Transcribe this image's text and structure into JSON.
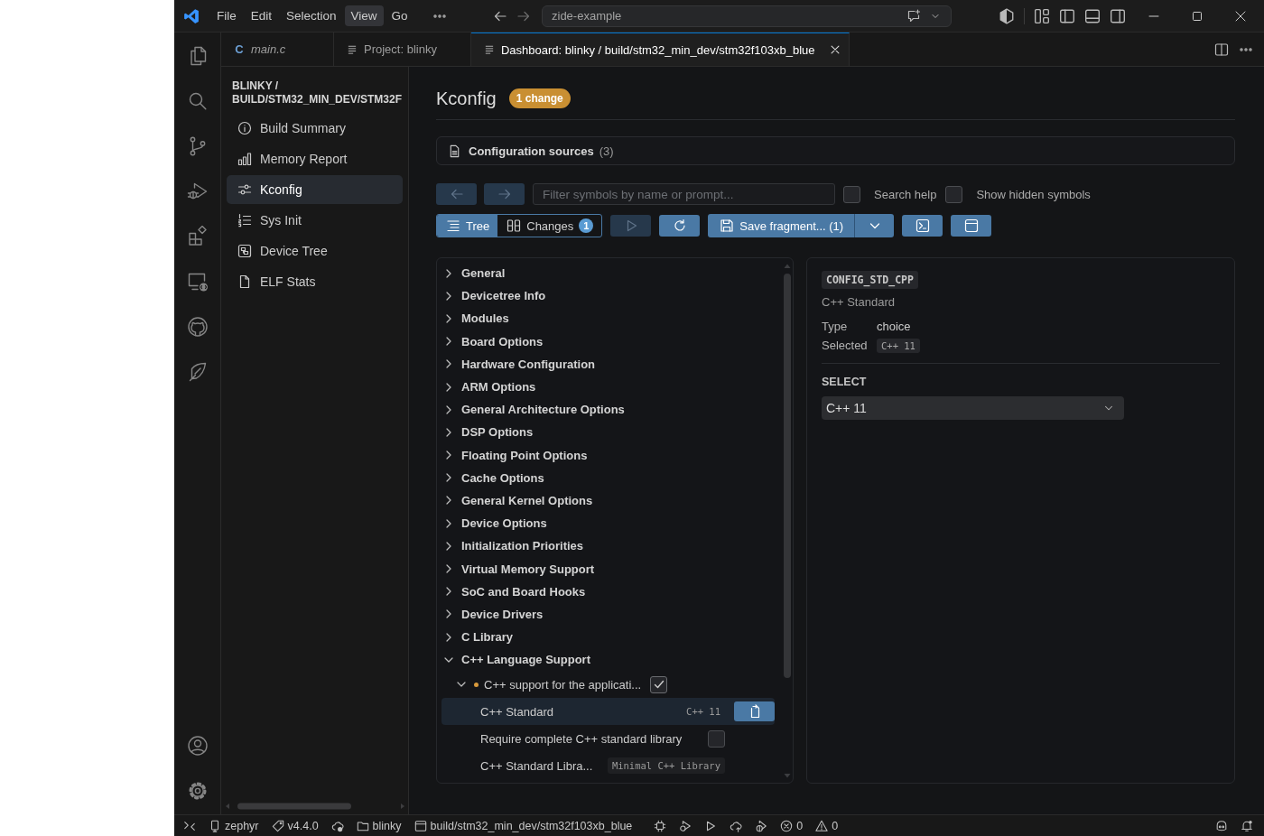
{
  "title_bar": {
    "menu": [
      {
        "label": "File",
        "selected": false
      },
      {
        "label": "Edit",
        "selected": false
      },
      {
        "label": "Selection",
        "selected": false
      },
      {
        "label": "View",
        "selected": true
      },
      {
        "label": "Go",
        "selected": false
      }
    ],
    "command_center": "zide-example"
  },
  "tabs": [
    {
      "label": "main.c",
      "kind": "source",
      "icon_text": "C",
      "preview": true,
      "selected": false
    },
    {
      "label": "Project: blinky",
      "kind": "document",
      "preview": false,
      "selected": false
    },
    {
      "label": "Dashboard: blinky / build/stm32_min_dev/stm32f103xb_blue",
      "kind": "document",
      "preview": false,
      "selected": true
    }
  ],
  "dashboard_nav": {
    "title": "BLINKY / BUILD/STM32_MIN_DEV/STM32F",
    "items": [
      {
        "label": "Build Summary",
        "kind": "summary",
        "selected": false
      },
      {
        "label": "Memory Report",
        "kind": "memory",
        "selected": false
      },
      {
        "label": "Kconfig",
        "kind": "kconfig",
        "selected": true
      },
      {
        "label": "Sys Init",
        "kind": "sysinit",
        "selected": false
      },
      {
        "label": "Device Tree",
        "kind": "devicetree",
        "selected": false
      },
      {
        "label": "ELF Stats",
        "kind": "elf",
        "selected": false
      }
    ]
  },
  "kconfig": {
    "title": "Kconfig",
    "badge": "1 change",
    "sources": {
      "label": "Configuration sources",
      "count": "(3)"
    },
    "nav_buttons": [
      {
        "kind": "back",
        "disabled": true
      },
      {
        "kind": "forward",
        "disabled": true
      }
    ],
    "filter": {
      "placeholder": "Filter symbols by name or prompt..."
    },
    "options": [
      {
        "label": "Search help",
        "checked": false
      },
      {
        "label": "Show hidden symbols",
        "checked": false
      }
    ],
    "views": [
      {
        "label": "Tree",
        "kind": "tree",
        "selected": true
      },
      {
        "label": "Changes",
        "kind": "changes",
        "badge": "1",
        "selected": false
      }
    ],
    "actions": [
      {
        "kind": "run",
        "disabled": true
      },
      {
        "kind": "refresh",
        "disabled": false
      },
      {
        "kind": "save",
        "label": "Save fragment... (1)",
        "disabled": false
      },
      {
        "kind": "save-menu",
        "disabled": false
      },
      {
        "kind": "terminal",
        "disabled": false
      },
      {
        "kind": "panel",
        "disabled": false
      }
    ],
    "tree": {
      "items": [
        {
          "label": "General",
          "kind": "menu",
          "expanded": false,
          "selected": false
        },
        {
          "label": "Devicetree Info",
          "kind": "menu",
          "expanded": false,
          "selected": false
        },
        {
          "label": "Modules",
          "kind": "menu",
          "expanded": false,
          "selected": false
        },
        {
          "label": "Board Options",
          "kind": "menu",
          "expanded": false,
          "selected": false
        },
        {
          "label": "Hardware Configuration",
          "kind": "menu",
          "expanded": false,
          "selected": false
        },
        {
          "label": "ARM Options",
          "kind": "menu",
          "expanded": false,
          "selected": false
        },
        {
          "label": "General Architecture Options",
          "kind": "menu",
          "expanded": false,
          "selected": false
        },
        {
          "label": "DSP Options",
          "kind": "menu",
          "expanded": false,
          "selected": false
        },
        {
          "label": "Floating Point Options",
          "kind": "menu",
          "expanded": false,
          "selected": false
        },
        {
          "label": "Cache Options",
          "kind": "menu",
          "expanded": false,
          "selected": false
        },
        {
          "label": "General Kernel Options",
          "kind": "menu",
          "expanded": false,
          "selected": false
        },
        {
          "label": "Device Options",
          "kind": "menu",
          "expanded": false,
          "selected": false
        },
        {
          "label": "Initialization Priorities",
          "kind": "menu",
          "expanded": false,
          "selected": false
        },
        {
          "label": "Virtual Memory Support",
          "kind": "menu",
          "expanded": false,
          "selected": false
        },
        {
          "label": "SoC and Board Hooks",
          "kind": "menu",
          "expanded": false,
          "selected": false
        },
        {
          "label": "Device Drivers",
          "kind": "menu",
          "expanded": false,
          "selected": false
        },
        {
          "label": "C Library",
          "kind": "menu",
          "expanded": false,
          "selected": false
        },
        {
          "label": "C++ Language Support",
          "kind": "menu",
          "expanded": true,
          "selected": false,
          "children": [
            {
              "label": "C++ support for the applicati...",
              "kind": "bool",
              "checked": true,
              "modified": true,
              "expanded": true,
              "selected": false,
              "children": [
                {
                  "label": "C++ Standard",
                  "kind": "choice",
                  "value": "C++ 11",
                  "selected": true
                },
                {
                  "label": "Require complete C++ standard library",
                  "kind": "bool",
                  "checked": false,
                  "selected": false
                },
                {
                  "label": "C++ Standard Libra...",
                  "kind": "choice",
                  "value": "Minimal C++ Library",
                  "selected": false
                }
              ]
            }
          ]
        }
      ]
    },
    "detail": {
      "symbol": "CONFIG_STD_CPP",
      "prompt": "C++ Standard",
      "properties": [
        {
          "label": "Type",
          "value": "choice",
          "kind": "text"
        },
        {
          "label": "Selected",
          "value": "C++ 11",
          "kind": "code"
        }
      ],
      "section": "SELECT",
      "select": {
        "value": "C++ 11"
      }
    }
  },
  "status_bar": {
    "board": "zephyr",
    "version": "v4.4.0",
    "project": "blinky",
    "build_dir": "build/stm32_min_dev/stm32f103xb_blue",
    "errors": "0",
    "warnings": "0"
  }
}
